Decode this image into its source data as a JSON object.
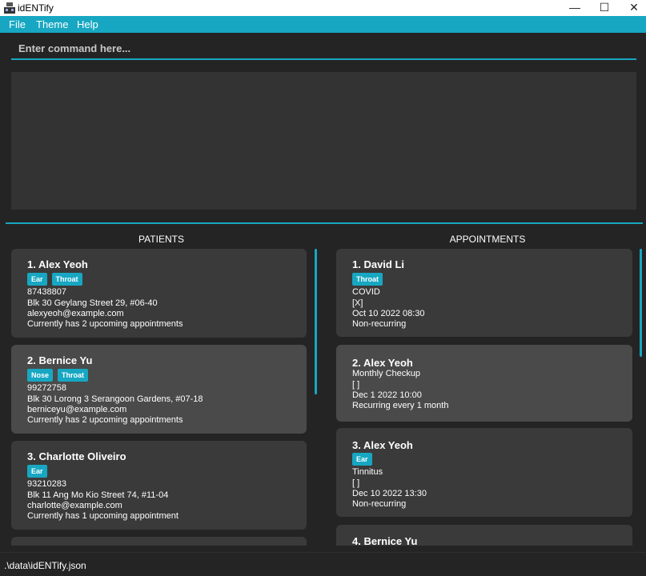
{
  "window": {
    "title": "idENTify"
  },
  "menu": [
    "File",
    "Theme",
    "Help"
  ],
  "command": {
    "placeholder": "Enter command here..."
  },
  "panels": {
    "patients_title": "PATIENTS",
    "appointments_title": "APPOINTMENTS"
  },
  "patients": [
    {
      "index_name": "1.  Alex Yeoh",
      "tags": [
        "Ear",
        "Throat"
      ],
      "phone": "87438807",
      "address": "Blk 30 Geylang Street 29, #06-40",
      "email": "alexyeoh@example.com",
      "appointments": "Currently has 2 upcoming appointments"
    },
    {
      "index_name": "2.  Bernice Yu",
      "tags": [
        "Nose",
        "Throat"
      ],
      "phone": "99272758",
      "address": "Blk 30 Lorong 3 Serangoon Gardens, #07-18",
      "email": "berniceyu@example.com",
      "appointments": "Currently has 2 upcoming appointments"
    },
    {
      "index_name": "3.  Charlotte Oliveiro",
      "tags": [
        "Ear"
      ],
      "phone": "93210283",
      "address": "Blk 11 Ang Mo Kio Street 74, #11-04",
      "email": "charlotte@example.com",
      "appointments": "Currently has 1 upcoming appointment"
    }
  ],
  "appointments": [
    {
      "index_name": "1.  David Li",
      "tags": [
        "Throat"
      ],
      "reason": "COVID",
      "mark": "[X]",
      "datetime": "Oct 10 2022 08:30",
      "recurrence": "Non-recurring"
    },
    {
      "index_name": "2.  Alex Yeoh",
      "tags": [],
      "reason": "Monthly Checkup",
      "mark": "[ ]",
      "datetime": "Dec 1 2022 10:00",
      "recurrence": "Recurring every 1 month"
    },
    {
      "index_name": "3.  Alex Yeoh",
      "tags": [
        "Ear"
      ],
      "reason": "Tinnitus",
      "mark": "[ ]",
      "datetime": "Dec 10 2022 13:30",
      "recurrence": "Non-recurring"
    },
    {
      "index_name": "4.  Bernice Yu"
    }
  ],
  "status": {
    "file_path": ".\\data\\idENTify.json"
  },
  "colors": {
    "accent": "#17a7c2",
    "background": "#242424",
    "card": "#3a3a3a",
    "card_selected": "#4a4a4a"
  }
}
